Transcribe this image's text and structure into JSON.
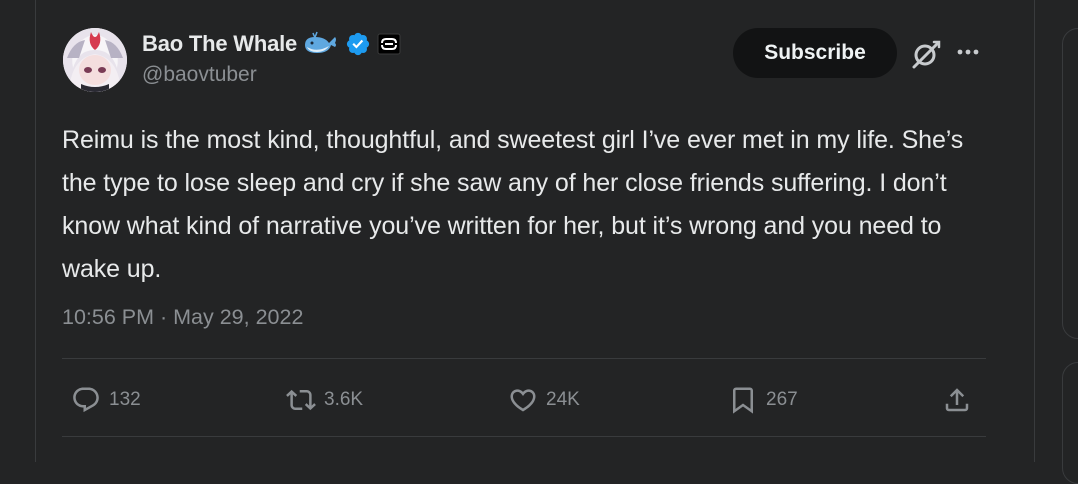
{
  "author": {
    "display_name": "Bao The Whale",
    "handle": "@baovtuber"
  },
  "header": {
    "subscribe_label": "Subscribe"
  },
  "tweet": {
    "text": "Reimu is the most kind, thoughtful, and sweetest girl I’ve ever met in my life. She’s the type to lose sleep and cry if she saw any of her close friends suffering. I don’t know what kind of narrative you’ve written for her, but it’s wrong and you need to wake up.",
    "timestamp": "10:56 PM · May 29, 2022"
  },
  "actions": {
    "replies": "132",
    "reposts": "3.6K",
    "likes": "24K",
    "bookmarks": "267"
  },
  "icons": {
    "verified": "verified-badge-icon",
    "whale": "whale-emoji-icon",
    "affiliate": "affiliate-badge-icon",
    "grok": "grok-icon",
    "more": "more-dots-icon",
    "reply": "reply-icon",
    "repost": "repost-icon",
    "like": "heart-icon",
    "bookmark": "bookmark-icon",
    "share": "share-icon"
  },
  "colors": {
    "background": "#232425",
    "text": "#e7e9ea",
    "secondary": "#8b8f93",
    "verified": "#1d9bf0"
  }
}
